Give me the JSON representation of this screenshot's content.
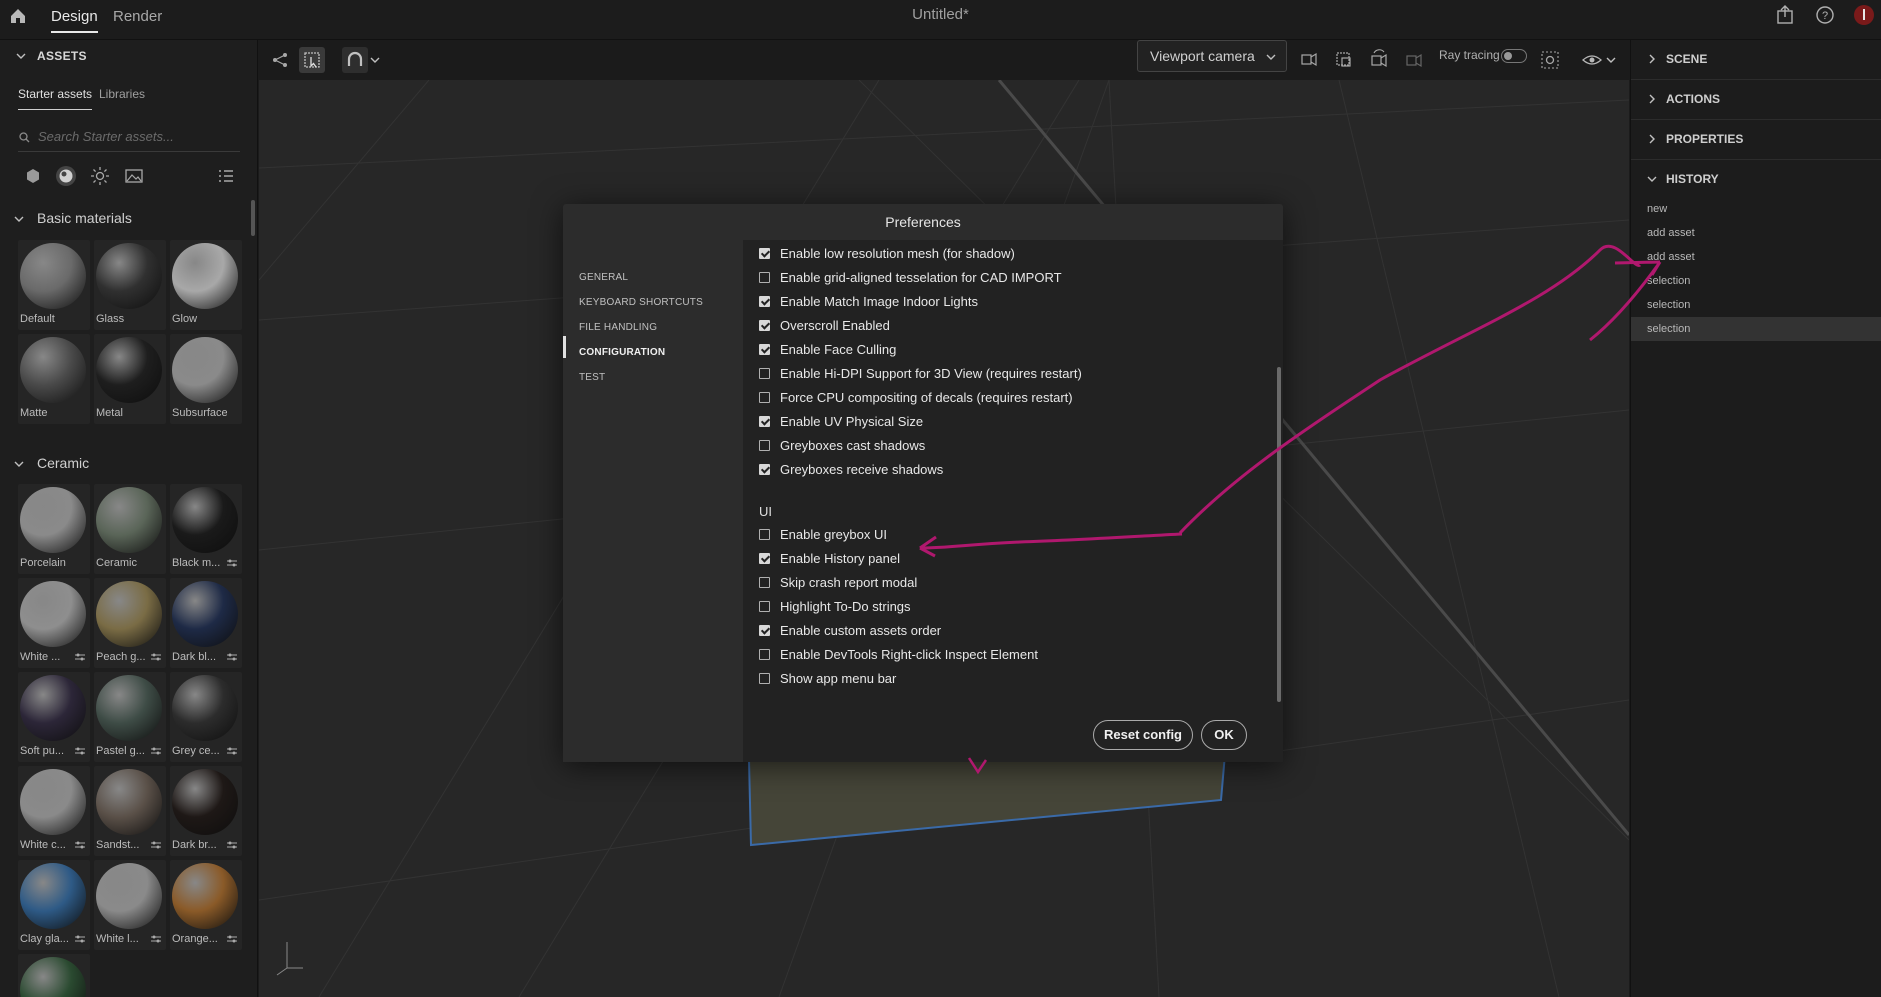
{
  "topbar": {
    "tabs": [
      "Design",
      "Render"
    ],
    "title": "Untitled*"
  },
  "left_panel": {
    "header": "ASSETS",
    "subtabs": [
      "Starter assets",
      "Libraries"
    ],
    "search_placeholder": "Search Starter assets...",
    "sections": [
      {
        "title": "Basic materials",
        "items": [
          {
            "label": "Default",
            "color": "#6a6a6a"
          },
          {
            "label": "Glass",
            "color": "#303030"
          },
          {
            "label": "Glow",
            "color": "#a8a8a8"
          },
          {
            "label": "Matte",
            "color": "#4a4a4a"
          },
          {
            "label": "Metal",
            "color": "#1e1e1e"
          },
          {
            "label": "Subsurface",
            "color": "#8a8a8a"
          }
        ]
      },
      {
        "title": "Ceramic",
        "items": [
          {
            "label": "Porcelain",
            "color": "#8a8a8a"
          },
          {
            "label": "Ceramic",
            "color": "#5a6558"
          },
          {
            "label": "Black m...",
            "color": "#1a1a1a"
          },
          {
            "label": "White ...",
            "color": "#8e8e8e"
          },
          {
            "label": "Peach g...",
            "color": "#7a6c45"
          },
          {
            "label": "Dark bl...",
            "color": "#1e2a46"
          },
          {
            "label": "Soft pu...",
            "color": "#2c2638"
          },
          {
            "label": "Pastel g...",
            "color": "#3e4c46"
          },
          {
            "label": "Grey ce...",
            "color": "#2c2c2c"
          },
          {
            "label": "White c...",
            "color": "#8a8a8a"
          },
          {
            "label": "Sandst...",
            "color": "#5a5048"
          },
          {
            "label": "Dark br...",
            "color": "#1e1816"
          },
          {
            "label": "Clay gla...",
            "color": "#2e5a86"
          },
          {
            "label": "White l...",
            "color": "#8a8a8a"
          },
          {
            "label": "Orange...",
            "color": "#8a5a28"
          },
          {
            "label": "",
            "color": "#2a4a30"
          }
        ]
      }
    ]
  },
  "viewport": {
    "camera_select": "Viewport camera",
    "ray_tracing_label": "Ray tracing"
  },
  "right_panel": {
    "sections": [
      "SCENE",
      "ACTIONS",
      "PROPERTIES",
      "HISTORY"
    ],
    "history": [
      "new",
      "add asset",
      "add asset",
      "selection",
      "selection",
      "selection"
    ]
  },
  "modal": {
    "title": "Preferences",
    "nav": [
      "GENERAL",
      "KEYBOARD SHORTCUTS",
      "FILE HANDLING",
      "CONFIGURATION",
      "TEST"
    ],
    "active_nav": "CONFIGURATION",
    "options": [
      {
        "label": "Enable low resolution mesh (for shadow)",
        "checked": true
      },
      {
        "label": "Enable grid-aligned tesselation for CAD IMPORT",
        "checked": false
      },
      {
        "label": "Enable Match Image Indoor Lights",
        "checked": true
      },
      {
        "label": "Overscroll Enabled",
        "checked": true
      },
      {
        "label": "Enable Face Culling",
        "checked": true
      },
      {
        "label": "Enable Hi-DPI Support for 3D View (requires restart)",
        "checked": false
      },
      {
        "label": "Force CPU compositing of decals (requires restart)",
        "checked": false
      },
      {
        "label": "Enable UV Physical Size",
        "checked": true
      },
      {
        "label": "Greyboxes cast shadows",
        "checked": false
      },
      {
        "label": "Greyboxes receive shadows",
        "checked": true
      }
    ],
    "ui_header": "UI",
    "ui_options": [
      {
        "label": "Enable greybox UI",
        "checked": false
      },
      {
        "label": "Enable History panel",
        "checked": true
      },
      {
        "label": "Skip crash report modal",
        "checked": false
      },
      {
        "label": "Highlight To-Do strings",
        "checked": false
      },
      {
        "label": "Enable custom assets order",
        "checked": true
      },
      {
        "label": "Enable DevTools Right-click Inspect Element",
        "checked": false
      },
      {
        "label": "Show app menu bar",
        "checked": false
      }
    ],
    "reset_label": "Reset config",
    "ok_label": "OK"
  },
  "annotation_color": "#b0186e"
}
